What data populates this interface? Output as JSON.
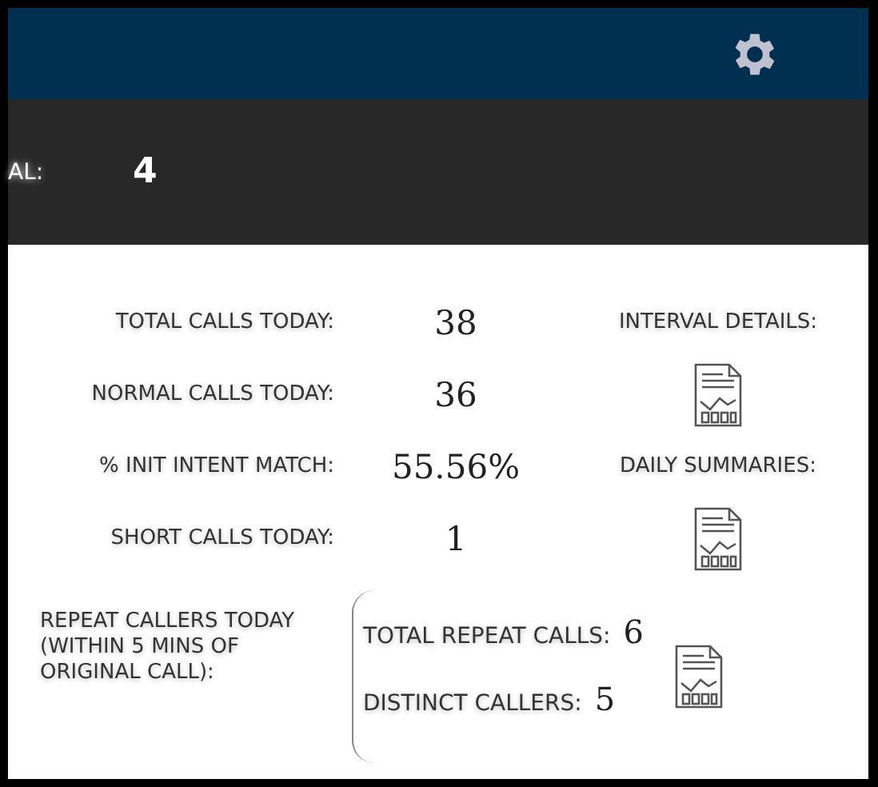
{
  "banner": {
    "label": "AL:",
    "value": "4"
  },
  "stats": [
    {
      "label": "TOTAL CALLS TODAY:",
      "value": "38"
    },
    {
      "label": "NORMAL CALLS TODAY:",
      "value": "36"
    },
    {
      "label": "% INIT INTENT MATCH:",
      "value": "55.56%"
    },
    {
      "label": "SHORT CALLS TODAY:",
      "value": "1"
    }
  ],
  "reports": [
    {
      "label": "INTERVAL DETAILS:"
    },
    {
      "label": "DAILY SUMMARIES:"
    }
  ],
  "repeat": {
    "label": "REPEAT CALLERS TODAY (WITHIN 5 MINS OF ORIGINAL CALL):",
    "items": [
      {
        "label": "TOTAL REPEAT CALLS:",
        "value": "6"
      },
      {
        "label": "DISTINCT CALLERS:",
        "value": "5"
      }
    ]
  }
}
